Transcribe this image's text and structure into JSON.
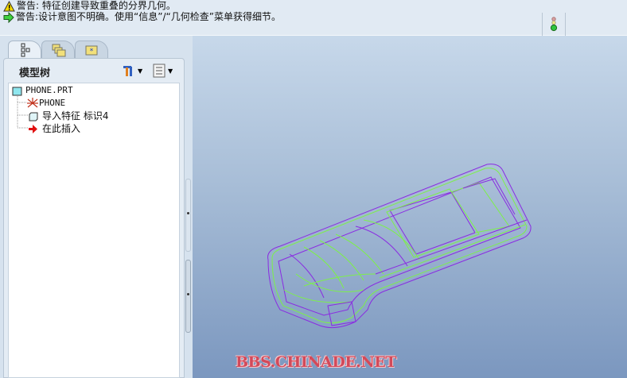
{
  "messages": [
    {
      "icon": "warning-icon",
      "text": "警告: 特征创建导致重叠的分界几何。"
    },
    {
      "icon": "arrow-right-icon",
      "text": "警告:设计意图不明确。使用“信息”/“几何检查”菜单获得细节。"
    }
  ],
  "status_light": "traffic-light-icon",
  "navigator": {
    "tabs": [
      "model-tree-tab",
      "folder-browser-tab",
      "favorites-tab"
    ],
    "title": "模型树",
    "tree": [
      {
        "label": "PHONE.PRT",
        "icon": "part-icon"
      },
      {
        "label": "PHONE",
        "icon": "csys-icon"
      },
      {
        "label": "导入特征 标识4",
        "icon": "import-feature-icon"
      },
      {
        "label": "在此插入",
        "icon": "insert-here-arrow-icon"
      }
    ]
  },
  "watermark": "BBS.CHINADE.NET",
  "colors": {
    "wire_green": "#7df04a",
    "wire_purple": "#8a2be2"
  }
}
